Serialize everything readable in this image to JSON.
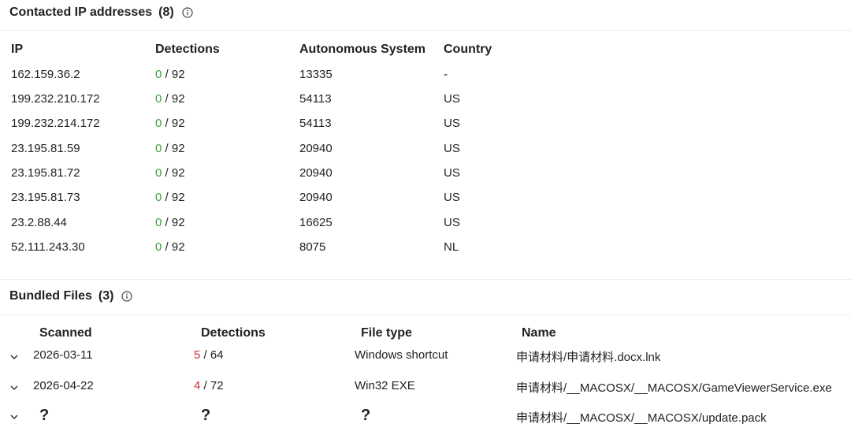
{
  "contacted": {
    "title": "Contacted IP addresses",
    "count": "(8)",
    "headers": {
      "ip": "IP",
      "detections": "Detections",
      "as": "Autonomous System",
      "country": "Country"
    },
    "rows": [
      {
        "ip": "162.159.36.2",
        "det": "0",
        "total": "/ 92",
        "as": "13335",
        "country": "-"
      },
      {
        "ip": "199.232.210.172",
        "det": "0",
        "total": "/ 92",
        "as": "54113",
        "country": "US"
      },
      {
        "ip": "199.232.214.172",
        "det": "0",
        "total": "/ 92",
        "as": "54113",
        "country": "US"
      },
      {
        "ip": "23.195.81.59",
        "det": "0",
        "total": "/ 92",
        "as": "20940",
        "country": "US"
      },
      {
        "ip": "23.195.81.72",
        "det": "0",
        "total": "/ 92",
        "as": "20940",
        "country": "US"
      },
      {
        "ip": "23.195.81.73",
        "det": "0",
        "total": "/ 92",
        "as": "20940",
        "country": "US"
      },
      {
        "ip": "23.2.88.44",
        "det": "0",
        "total": "/ 92",
        "as": "16625",
        "country": "US"
      },
      {
        "ip": "52.111.243.30",
        "det": "0",
        "total": "/ 92",
        "as": "8075",
        "country": "NL"
      }
    ]
  },
  "bundled": {
    "title": "Bundled Files",
    "count": "(3)",
    "headers": {
      "scanned": "Scanned",
      "detections": "Detections",
      "filetype": "File type",
      "name": "Name"
    },
    "rows": [
      {
        "scanned": "2026-03-11",
        "det": "5",
        "total": "/ 64",
        "filetype": "Windows shortcut",
        "name": "申请材料/申请材料.docx.lnk"
      },
      {
        "scanned": "2026-04-22",
        "det": "4",
        "total": "/ 72",
        "filetype": "Win32 EXE",
        "name": "申请材料/__MACOSX/__MACOSX/GameViewerService.exe"
      },
      {
        "scanned": "?",
        "det": "?",
        "total": "",
        "filetype": "?",
        "name": "申请材料/__MACOSX/__MACOSX/update.pack"
      }
    ]
  },
  "colors": {
    "clean": "#3aa13a",
    "malicious": "#d32f2f"
  },
  "icons": {
    "info": "info-icon",
    "expand": "chevron-down-icon"
  }
}
